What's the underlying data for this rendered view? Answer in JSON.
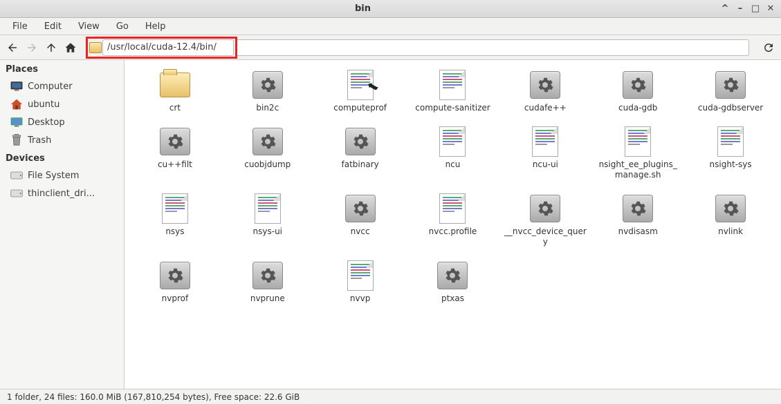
{
  "window": {
    "title": "bin"
  },
  "menubar": {
    "items": [
      "File",
      "Edit",
      "View",
      "Go",
      "Help"
    ]
  },
  "toolbar": {
    "path": "/usr/local/cuda-12.4/bin/"
  },
  "sidebar": {
    "places_header": "Places",
    "places": [
      {
        "label": "Computer",
        "icon": "monitor"
      },
      {
        "label": "ubuntu",
        "icon": "home"
      },
      {
        "label": "Desktop",
        "icon": "desktop"
      },
      {
        "label": "Trash",
        "icon": "trash"
      }
    ],
    "devices_header": "Devices",
    "devices": [
      {
        "label": "File System",
        "icon": "drive"
      },
      {
        "label": "thinclient_dri...",
        "icon": "drive"
      }
    ]
  },
  "files": [
    {
      "name": "crt",
      "type": "folder"
    },
    {
      "name": "bin2c",
      "type": "exec"
    },
    {
      "name": "computeprof",
      "type": "link-text"
    },
    {
      "name": "compute-sanitizer",
      "type": "text"
    },
    {
      "name": "cudafe++",
      "type": "exec"
    },
    {
      "name": "cuda-gdb",
      "type": "exec"
    },
    {
      "name": "cuda-gdbserver",
      "type": "exec"
    },
    {
      "name": "cu++filt",
      "type": "exec"
    },
    {
      "name": "cuobjdump",
      "type": "exec"
    },
    {
      "name": "fatbinary",
      "type": "exec"
    },
    {
      "name": "ncu",
      "type": "text"
    },
    {
      "name": "ncu-ui",
      "type": "text"
    },
    {
      "name": "nsight_ee_plugins_manage.sh",
      "type": "text"
    },
    {
      "name": "nsight-sys",
      "type": "text"
    },
    {
      "name": "nsys",
      "type": "text"
    },
    {
      "name": "nsys-ui",
      "type": "text"
    },
    {
      "name": "nvcc",
      "type": "exec"
    },
    {
      "name": "nvcc.profile",
      "type": "text"
    },
    {
      "name": "__nvcc_device_query",
      "type": "exec"
    },
    {
      "name": "nvdisasm",
      "type": "exec"
    },
    {
      "name": "nvlink",
      "type": "exec"
    },
    {
      "name": "nvprof",
      "type": "exec"
    },
    {
      "name": "nvprune",
      "type": "exec"
    },
    {
      "name": "nvvp",
      "type": "text"
    },
    {
      "name": "ptxas",
      "type": "exec"
    }
  ],
  "statusbar": {
    "text": "1 folder, 24 files: 160.0 MiB (167,810,254 bytes), Free space: 22.6 GiB"
  }
}
